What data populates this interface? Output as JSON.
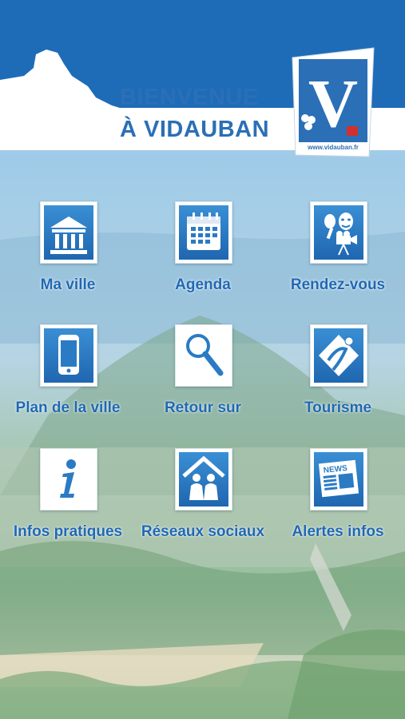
{
  "header": {
    "welcome_line1": "BIENVENUE",
    "welcome_line2": "À VIDAUBAN",
    "logo_letter": "V",
    "logo_url": "www.vidauban.fr"
  },
  "menu": [
    {
      "label": "Ma ville",
      "icon": "town-hall-icon"
    },
    {
      "label": "Agenda",
      "icon": "calendar-icon"
    },
    {
      "label": "Rendez-vous",
      "icon": "theater-masks-icon"
    },
    {
      "label": "Plan de la ville",
      "icon": "smartphone-icon"
    },
    {
      "label": "Retour sur",
      "icon": "magnifier-icon"
    },
    {
      "label": "Tourisme",
      "icon": "tourism-icon"
    },
    {
      "label": "Infos pratiques",
      "icon": "info-icon"
    },
    {
      "label": "Réseaux sociaux",
      "icon": "social-network-icon"
    },
    {
      "label": "Alertes infos",
      "icon": "newspaper-icon"
    }
  ],
  "colors": {
    "brand_blue": "#2b6fb6",
    "label_blue": "#1f68b3",
    "tile_blue": "#2a7bc4"
  }
}
